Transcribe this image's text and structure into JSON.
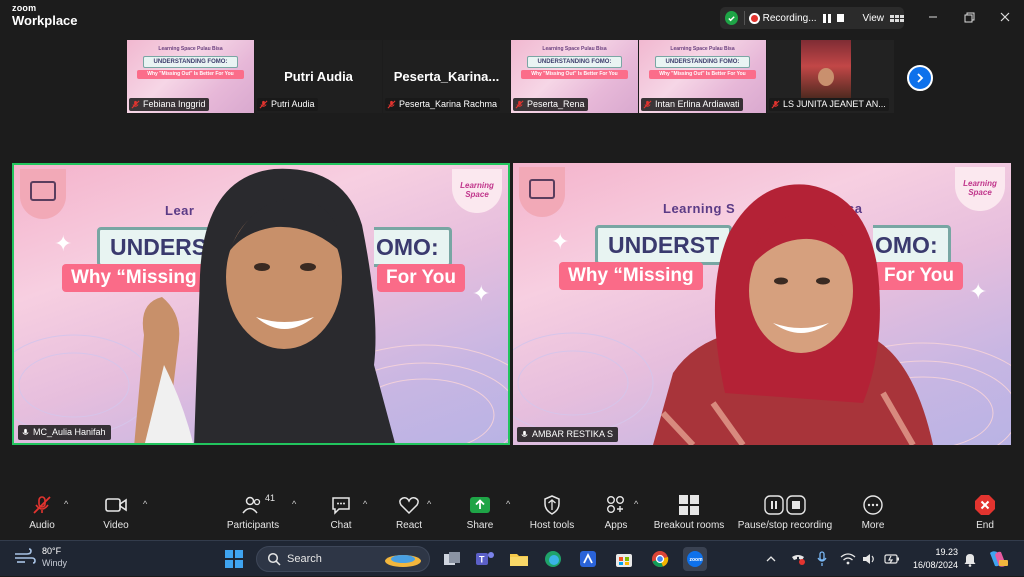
{
  "app": {
    "brand_small": "zoom",
    "brand_large": "Workplace",
    "recording_label": "Recording...",
    "view_label": "View"
  },
  "participants_strip": [
    {
      "name": "Febiana Inggrid",
      "kind": "slide",
      "muted": true
    },
    {
      "name": "Putri Audia",
      "kind": "name",
      "display": "Putri Audia",
      "muted": true
    },
    {
      "name": "Peserta_Karina Rachma",
      "kind": "name",
      "display": "Peserta_Karina...",
      "muted": true
    },
    {
      "name": "Peserta_Rena",
      "kind": "slide",
      "muted": true
    },
    {
      "name": "Intan Erlina Ardiawati",
      "kind": "slide",
      "muted": true
    },
    {
      "name": "LS JUNITA JEANET AN...",
      "kind": "photo",
      "muted": true
    }
  ],
  "mini_slide": {
    "top_text": "Learning Space Pulau Bisa",
    "title": "UNDERSTANDING FOMO:",
    "subtitle": "Why \"Missing Out\" Is Better For You"
  },
  "main_videos": [
    {
      "name": "MC_Aulia Hanifah",
      "heading": "Lear",
      "title": "UNDERS",
      "title_right": "OMO:",
      "sub_left": "Why “Missing",
      "sub_right": "For You",
      "badge": "Learning Space",
      "active_speaker": true
    },
    {
      "name": "AMBAR RESTIKA S",
      "heading": "Learning S",
      "heading_right": "sa",
      "title": "UNDERST",
      "title_right": "OMO:",
      "sub_left": "Why “Missing",
      "sub_right": "For You",
      "badge": "Learning Space",
      "active_speaker": false
    }
  ],
  "toolbar": {
    "audio": "Audio",
    "video": "Video",
    "participants": "Participants",
    "participants_count": "41",
    "chat": "Chat",
    "react": "React",
    "share": "Share",
    "host_tools": "Host tools",
    "apps": "Apps",
    "breakout": "Breakout rooms",
    "pause_stop": "Pause/stop recording",
    "more": "More",
    "end": "End"
  },
  "taskbar": {
    "temp": "80°F",
    "weather": "Windy",
    "search_placeholder": "Search",
    "time": "19.23",
    "date": "16/08/2024"
  },
  "colors": {
    "active_speaker_border": "#22c55e",
    "share_green": "#1ea446",
    "end_red": "#e3342f",
    "zoom_blue": "#0e71eb"
  }
}
